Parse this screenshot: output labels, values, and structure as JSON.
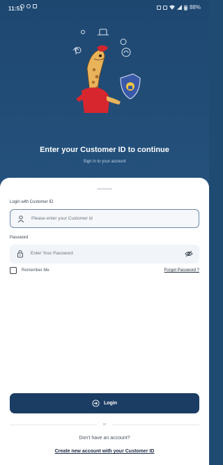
{
  "status_bar": {
    "time": "11:51",
    "battery": "88%"
  },
  "header": {
    "title": "Enter your Customer ID to continue",
    "subtitle": "Sign in to your account"
  },
  "form": {
    "customer_id": {
      "label": "Login with Customer ID",
      "placeholder": "Please enter your Customer id"
    },
    "password": {
      "label": "Password",
      "placeholder": "Enter Your Password"
    },
    "remember_label": "Remember Me",
    "forgot_label": "Forgot Password ?",
    "login_label": "Login",
    "or_label": "or",
    "no_account_text": "Don't have an account?",
    "create_account_label": "Create new account with your Customer ID"
  },
  "colors": {
    "header_bg": "#1e4770",
    "primary_button": "#1b3c63",
    "field_bg": "#f1f4f8",
    "active_border": "#6a89ad",
    "shield": "#3a58a8",
    "mascot_shirt": "#d7262e"
  },
  "icons": [
    "user-icon",
    "lock-icon",
    "eye-off-icon",
    "login-icon",
    "shield-icon"
  ]
}
